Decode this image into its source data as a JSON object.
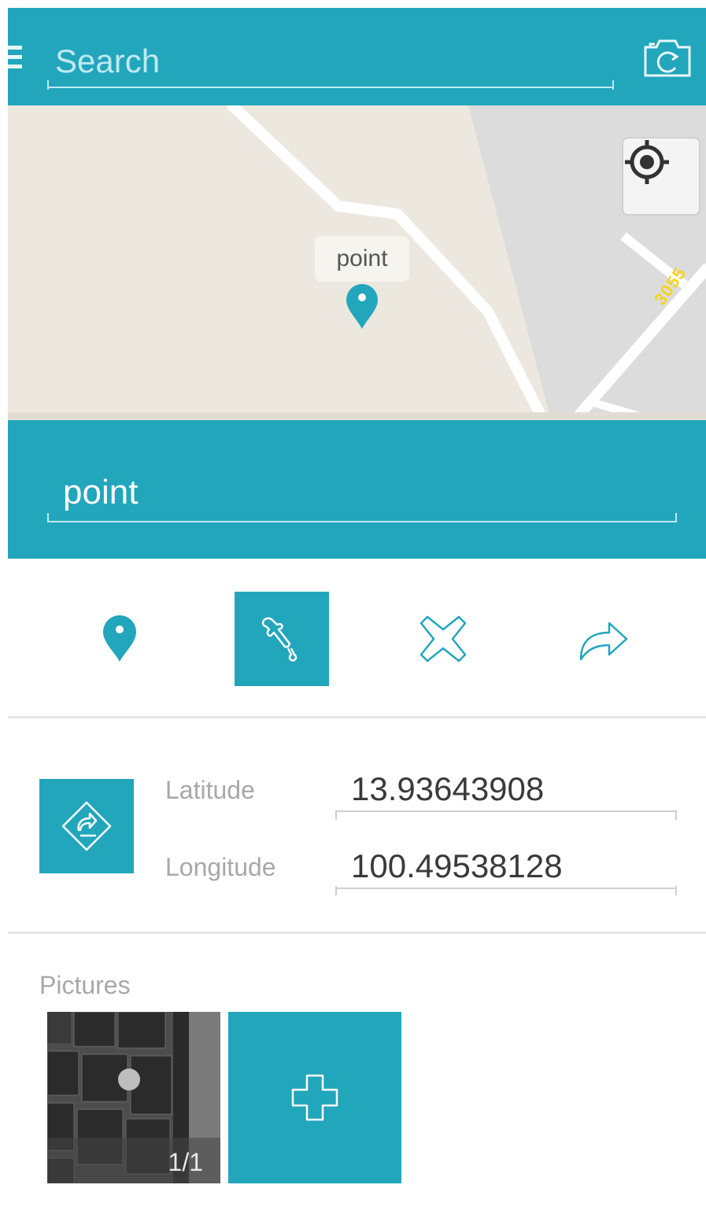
{
  "search": {
    "placeholder": "Search"
  },
  "map": {
    "marker_label": "point",
    "road_number": "3055"
  },
  "point": {
    "name": "point"
  },
  "tools": [
    {
      "name": "marker-tool",
      "active": false
    },
    {
      "name": "eyedropper-tool",
      "active": true
    },
    {
      "name": "delete-tool",
      "active": false
    },
    {
      "name": "share-tool",
      "active": false
    }
  ],
  "coordinates": {
    "latitude_label": "Latitude",
    "latitude_value": "13.93643908",
    "longitude_label": "Longitude",
    "longitude_value": "100.49538128"
  },
  "pictures": {
    "label": "Pictures",
    "counter": "1/1"
  },
  "colors": {
    "accent": "#22a6bc",
    "map_background": "#ece8df",
    "road": "#ffffff",
    "road_label": "#f4d51a"
  },
  "icons": [
    "menu-icon",
    "camera-icon",
    "locate-icon",
    "map-marker-icon",
    "eyedropper-icon",
    "close-icon",
    "share-icon",
    "sync-icon",
    "plus-icon"
  ]
}
